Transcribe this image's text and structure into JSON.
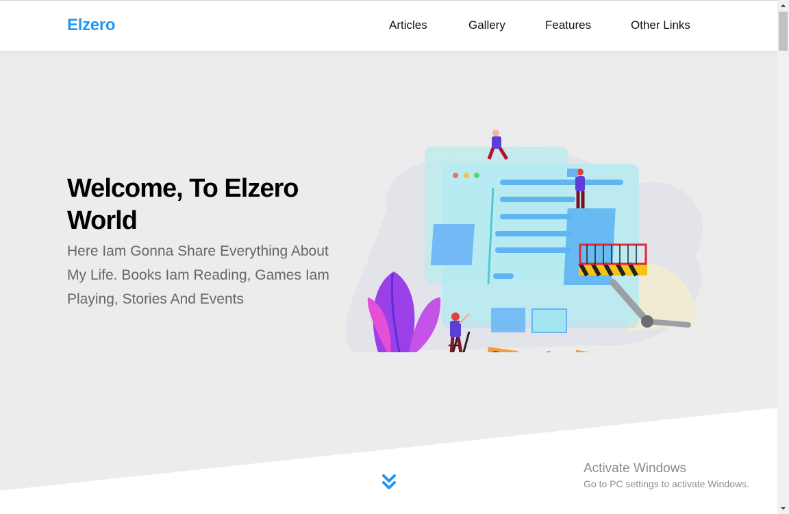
{
  "header": {
    "logo": "Elzero",
    "nav": [
      "Articles",
      "Gallery",
      "Features",
      "Other Links"
    ]
  },
  "landing": {
    "title": "Welcome, To Elzero World",
    "subtitle": "Here Iam Gonna Share Everything About My Life. Books Iam Reading, Games Iam Playing, Stories And Events",
    "illustration_icon": "team-building-website-illustration",
    "go_down_icon": "double-chevron-down-icon"
  },
  "os_watermark": {
    "title": "Activate Windows",
    "subtitle": "Go to PC settings to activate Windows."
  },
  "colors": {
    "brand": "#2196f3",
    "section_bg": "#ececec",
    "header_bg": "#ffffff",
    "text_muted": "#666666"
  }
}
